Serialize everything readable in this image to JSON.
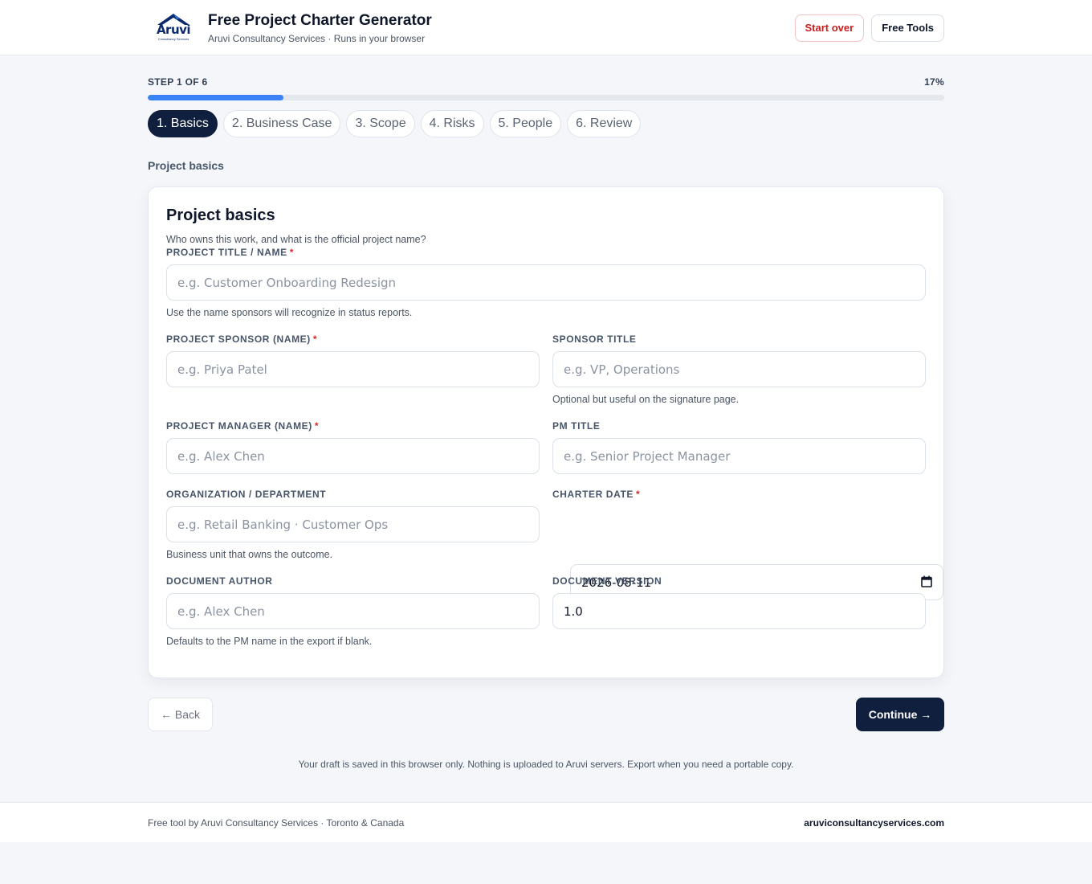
{
  "header": {
    "logo_word": "Aruvi",
    "logo_sub": "Consultancy Services",
    "title": "Free Project Charter Generator",
    "subtitle": "Aruvi Consultancy Services · Runs in your browser",
    "start_over": "Start over",
    "free_tools": "Free Tools"
  },
  "progress": {
    "step_text": "STEP 1 OF 6",
    "percent_text": "17%",
    "percent": 17
  },
  "steps": [
    {
      "label": "1. Basics"
    },
    {
      "label": "2. Business Case"
    },
    {
      "label": "3. Scope"
    },
    {
      "label": "4. Risks"
    },
    {
      "label": "5. People"
    },
    {
      "label": "6. Review"
    }
  ],
  "section_label": "Project basics",
  "card": {
    "title": "Project basics",
    "description": "Who owns this work, and what is the official project name?"
  },
  "fields": {
    "project_title": {
      "label": "Project title / name",
      "placeholder": "e.g. Customer Onboarding Redesign",
      "hint": "Use the name sponsors will recognize in status reports."
    },
    "sponsor_name": {
      "label": "Project sponsor (name)",
      "placeholder": "e.g. Priya Patel"
    },
    "sponsor_title": {
      "label": "Sponsor title",
      "placeholder": "e.g. VP, Operations",
      "hint": "Optional but useful on the signature page."
    },
    "pm_name": {
      "label": "Project manager (name)",
      "placeholder": "e.g. Alex Chen"
    },
    "pm_title": {
      "label": "PM title",
      "placeholder": "e.g. Senior Project Manager"
    },
    "organization": {
      "label": "Organization / department",
      "placeholder": "e.g. Retail Banking · Customer Ops",
      "hint": "Business unit that owns the outcome."
    },
    "charter_date": {
      "label": "Charter date",
      "value": "2026-08-11"
    },
    "doc_author": {
      "label": "Document author",
      "placeholder": "e.g. Alex Chen",
      "hint": "Defaults to the PM name in the export if blank."
    },
    "doc_version": {
      "label": "Document version",
      "value": "1.0"
    }
  },
  "nav": {
    "back": "← Back",
    "continue": "Continue →"
  },
  "draft_note": "Your draft is saved in this browser only. Nothing is uploaded to Aruvi servers. Export when you need a portable copy.",
  "footer": {
    "left": "Free tool by Aruvi Consultancy Services · Toronto & Canada",
    "right": "aruviconsultancyservices.com"
  },
  "colors": {
    "accent": "#3b82f6",
    "primary_dark": "#0f1f3d",
    "danger": "#c81e1e"
  },
  "icons": [
    "aruvi-logo",
    "calendar-icon"
  ]
}
